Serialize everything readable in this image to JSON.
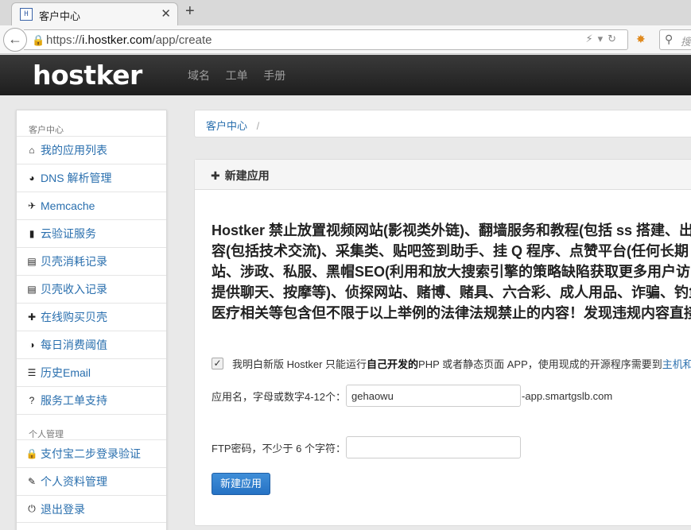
{
  "browser": {
    "tab_title": "客户中心",
    "favicon_text": "H",
    "url_prefix": "https://",
    "url_host": "i.hostker.com",
    "url_path": "/app/create",
    "search_placeholder": "搜"
  },
  "header": {
    "logo": "hostker",
    "nav": [
      "域名",
      "工单",
      "手册"
    ]
  },
  "sidebar": {
    "section1_title": "客户中心",
    "items1": [
      {
        "label": "我的应用列表",
        "icon": "home-icon",
        "glyph": "⌂"
      },
      {
        "label": "DNS 解析管理",
        "icon": "globe-icon",
        "glyph": "◕"
      },
      {
        "label": "Memcache",
        "icon": "plane-icon",
        "glyph": "✈"
      },
      {
        "label": "云验证服务",
        "icon": "signal-icon",
        "glyph": "▮"
      },
      {
        "label": "贝壳消耗记录",
        "icon": "list-alt-icon",
        "glyph": "▤"
      },
      {
        "label": "贝壳收入记录",
        "icon": "list-alt-icon",
        "glyph": "▤"
      },
      {
        "label": "在线购买贝壳",
        "icon": "plus-icon",
        "glyph": "✚"
      },
      {
        "label": "每日消费阈值",
        "icon": "adjust-icon",
        "glyph": "◑"
      },
      {
        "label": "历史Email",
        "icon": "th-list-icon",
        "glyph": "☰"
      },
      {
        "label": "服务工单支持",
        "icon": "question-icon",
        "glyph": "?"
      }
    ],
    "section2_title": "个人管理",
    "items2": [
      {
        "label": "支付宝二步登录验证",
        "icon": "lock-icon",
        "glyph": "🔒"
      },
      {
        "label": "个人资料管理",
        "icon": "edit-icon",
        "glyph": "✎"
      },
      {
        "label": "退出登录",
        "icon": "power-icon",
        "glyph": "⏻"
      }
    ]
  },
  "breadcrumb": {
    "home": "客户中心",
    "separator": "/"
  },
  "panel": {
    "title": "新建应用",
    "notice_lines": [
      "Hostker 禁止放置视频网站(影视类外链)、翻墙服务和教程(包括 ss 搭建、出",
      "容(包括技术交流)、采集类、贴吧签到助手、挂 Q 程序、点赞平台(任何长期",
      "站、涉政、私服、黑帽SEO(利用和放大搜索引擎的策略缺陷获取更多用户访问",
      "提供聊天、按摩等)、侦探网站、赌博、赌具、六合彩、成人用品、诈骗、钓鱼",
      "医疗相关等包含但不限于以上举例的法律法规禁止的内容！发现违规内容直接"
    ],
    "agree_prefix": "我明白新版 Hostker 只能运行",
    "agree_bold": "自己开发的",
    "agree_suffix": " PHP 或者静态页面 APP，使用现成的开源程序需要到",
    "agree_link": "主机和",
    "appname_label": "应用名，字母或数字4-12个：",
    "appname_value": "gehaowu",
    "appname_suffix": "-app.smartgslb.com",
    "ftp_label": "FTP密码，不少于 6 个字符：",
    "ftp_value": "",
    "submit": "新建应用"
  }
}
